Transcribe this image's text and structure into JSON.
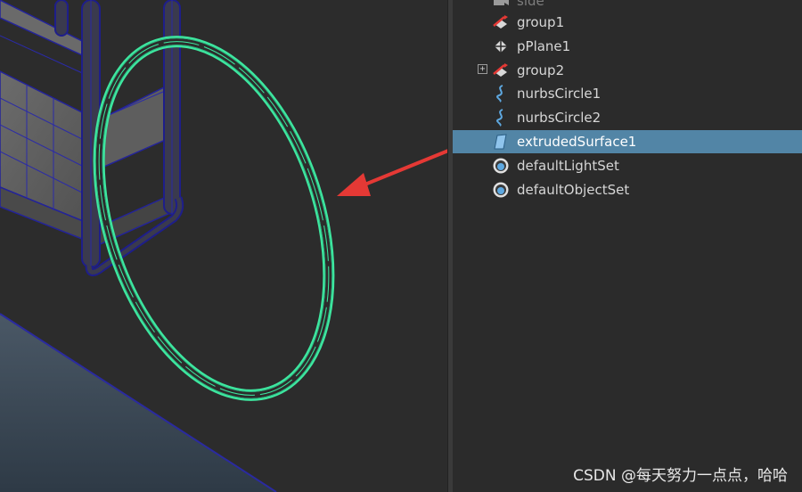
{
  "outliner": {
    "items": [
      {
        "label": "side",
        "icon": "camera-icon",
        "partial": true,
        "expander": ""
      },
      {
        "label": "group1",
        "icon": "group-icon",
        "expander": ""
      },
      {
        "label": "pPlane1",
        "icon": "polygon-mesh-icon",
        "expander": ""
      },
      {
        "label": "group2",
        "icon": "group-icon",
        "expander": "+"
      },
      {
        "label": "nurbsCircle1",
        "icon": "nurbs-curve-icon",
        "expander": ""
      },
      {
        "label": "nurbsCircle2",
        "icon": "nurbs-curve-icon",
        "expander": ""
      },
      {
        "label": "extrudedSurface1",
        "icon": "nurbs-surface-icon",
        "selected": true,
        "expander": ""
      },
      {
        "label": "defaultLightSet",
        "icon": "set-icon",
        "expander": ""
      },
      {
        "label": "defaultObjectSet",
        "icon": "set-icon",
        "expander": ""
      }
    ]
  },
  "watermark": "CSDN @每天努力一点点，哈哈",
  "colors": {
    "selection": "#5285a6",
    "selected_wire": "#3ee8a0",
    "unselected_wire": "#1e1e8a",
    "annotation_arrow": "#e53935"
  }
}
